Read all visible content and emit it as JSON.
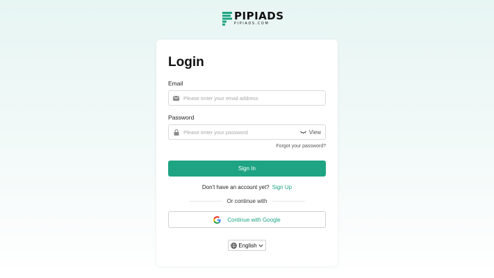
{
  "brand": {
    "name": "PIPIADS",
    "domain": "PIPIADS.COM",
    "color": "#1ea483"
  },
  "login": {
    "title": "Login",
    "email_label": "Email",
    "email_placeholder": "Please enter your email address",
    "email_value": "",
    "password_label": "Password",
    "password_placeholder": "Please enter your password",
    "password_value": "",
    "view_label": "View",
    "forgot_label": "Forgot your password?",
    "signin_label": "Sign In",
    "no_account_text": "Don't have an account yet?",
    "signup_label": "Sign Up",
    "or_continue_text": "Or continue with",
    "google_label": "Continue with Google"
  },
  "language": {
    "selected": "English"
  },
  "icons": {
    "email": "envelope-icon",
    "password": "lock-icon",
    "view": "eye-closed-icon",
    "google": "google-icon",
    "language": "globe-icon",
    "dropdown": "chevron-down-icon"
  }
}
